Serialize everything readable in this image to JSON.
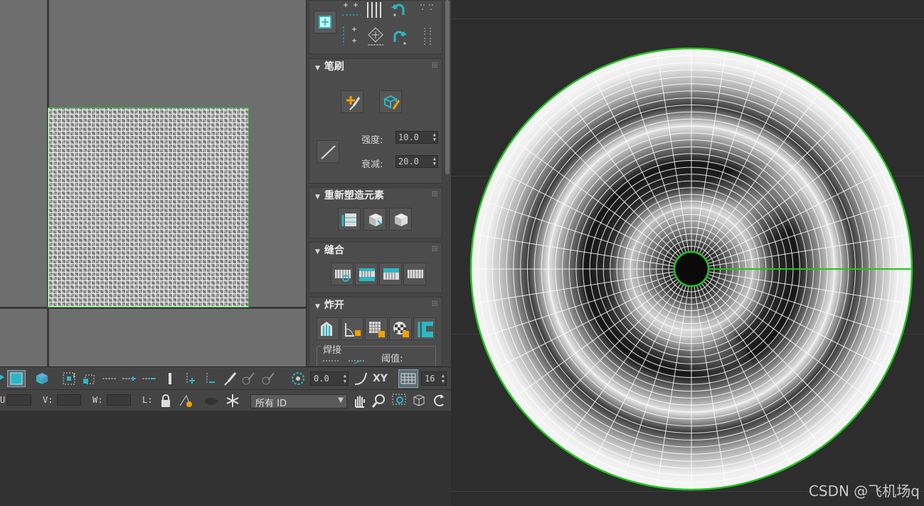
{
  "panel": {
    "brush": {
      "title": "笔刷",
      "strength_label": "强度:",
      "strength_value": "10.0",
      "falloff_label": "衰减:",
      "falloff_value": "20.0"
    },
    "reshape": {
      "title": "重新塑造元素"
    },
    "stitch": {
      "title": "缝合"
    },
    "explode": {
      "title": "炸开",
      "weld_label": "焊接",
      "threshold_label": "阈值:"
    }
  },
  "toolbar": {
    "rotate_value": "0.0",
    "xy_label": "XY",
    "grid_value": "16",
    "u_label": "U",
    "v_label": "V:",
    "w_label": "W:",
    "l_label": "L:",
    "id_filter_value": "所有 ID"
  },
  "watermark": "CSDN @飞机场q",
  "colors": {
    "accent": "#2ab7c4",
    "selection": "#21c51f",
    "panel": "#444444",
    "viewport": "#2d2d2d"
  }
}
